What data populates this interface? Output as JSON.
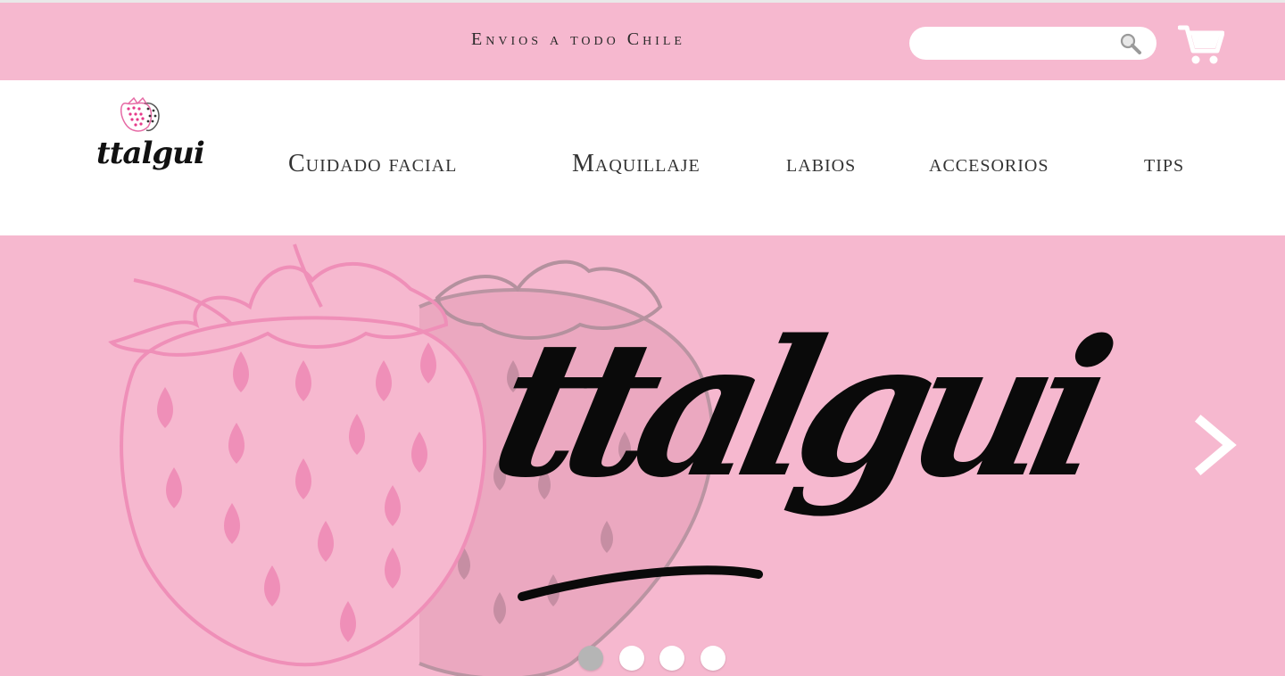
{
  "topbar": {
    "announcement": "Envios a todo Chile",
    "search": {
      "value": "",
      "placeholder": ""
    },
    "search_icon": "search-icon",
    "cart_icon": "cart-icon"
  },
  "header": {
    "logo_text": "ttalgui",
    "nav": [
      {
        "label": "Cuidado  facial"
      },
      {
        "label": "Maquillaje"
      },
      {
        "label": "labios"
      },
      {
        "label": "accesorios"
      },
      {
        "label": "tips"
      }
    ]
  },
  "hero": {
    "headline": "ttalgui",
    "next_icon": "chevron-right-icon",
    "slides_total": 4,
    "active_slide": 1
  },
  "colors": {
    "brand_pink": "#f6b8cf",
    "accent_pink": "#ef8fb8",
    "text_dark": "#333333",
    "dot_active": "#b5b5b5",
    "white": "#ffffff"
  }
}
